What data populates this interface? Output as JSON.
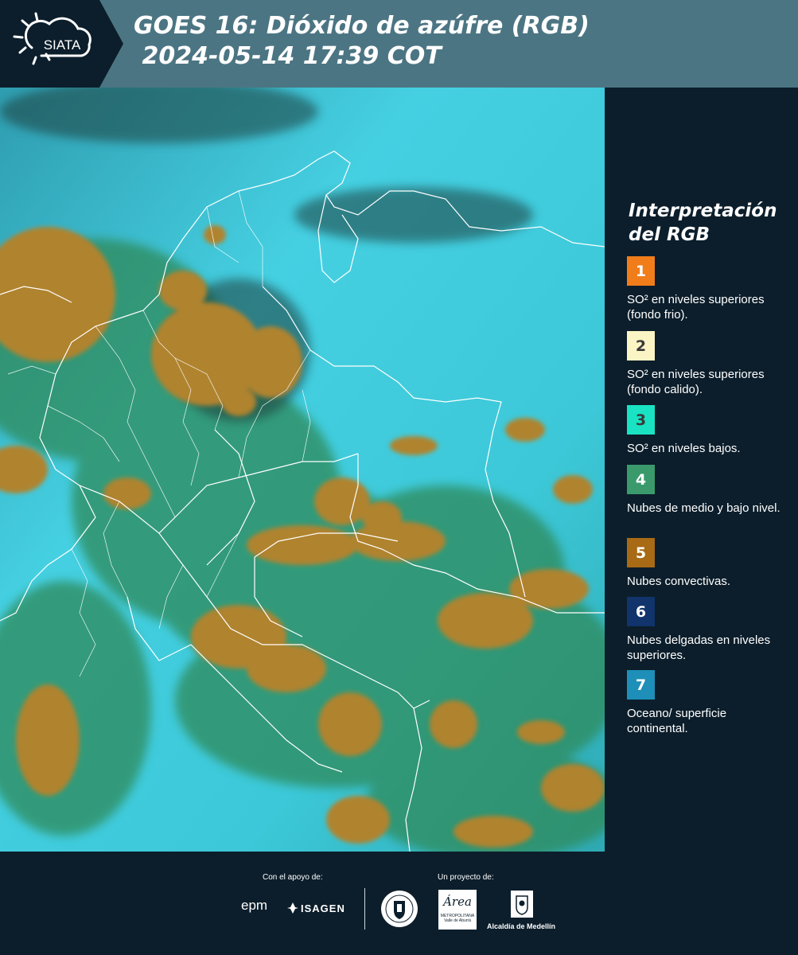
{
  "header": {
    "logo_text": "SIATA",
    "title_line1": "GOES 16: Dióxido de azúfre (RGB)",
    "title_line2": " 2024-05-14 17:39 COT",
    "bg_color": "#4c7583",
    "logo_bg_color": "#0c1e2b"
  },
  "map": {
    "icon": "satellite-rgb-map",
    "colors": {
      "surface": "#3ccfe0",
      "convective": "#b0832d",
      "mid_low": "#2f8a5a",
      "thin_high": "#1a3c3a"
    }
  },
  "legend": {
    "title_line1": "Interpretación",
    "title_line2": "del RGB",
    "items": [
      {
        "num": "1",
        "label": "SO² en niveles superiores (fondo frio).",
        "color": "#f07d1a",
        "num_color": "#ffffff"
      },
      {
        "num": "2",
        "label": "SO² en niveles superiores (fondo calido).",
        "color": "#fbf4c4",
        "num_color": "#3a3a3a"
      },
      {
        "num": "3",
        "label": "SO² en niveles bajos.",
        "color": "#19e3c2",
        "num_color": "#3a3a3a"
      },
      {
        "num": "4",
        "label": "Nubes de medio y bajo nivel.",
        "color": "#3a9a6c",
        "num_color": "#ffffff"
      },
      {
        "num": "5",
        "label": "Nubes convectivas.",
        "color": "#a86a14",
        "num_color": "#ffffff"
      },
      {
        "num": "6",
        "label": "Nubes delgadas en niveles superiores.",
        "color": "#10346b",
        "num_color": "#ffffff"
      },
      {
        "num": "7",
        "label": "Oceano/ superficie continental.",
        "color": "#1d8fb8",
        "num_color": "#ffffff"
      }
    ]
  },
  "footer": {
    "support_label": "Con el apoyo de:",
    "project_label": "Un proyecto de:",
    "sponsor_epm": "epm",
    "sponsor_isagen": "ISAGEN",
    "area_metro_name": "Área",
    "area_metro_sub": "METROPOLITANA",
    "area_metro_sub2": "Valle de Aburrá",
    "alcaldia": "Alcaldía de Medellín"
  }
}
